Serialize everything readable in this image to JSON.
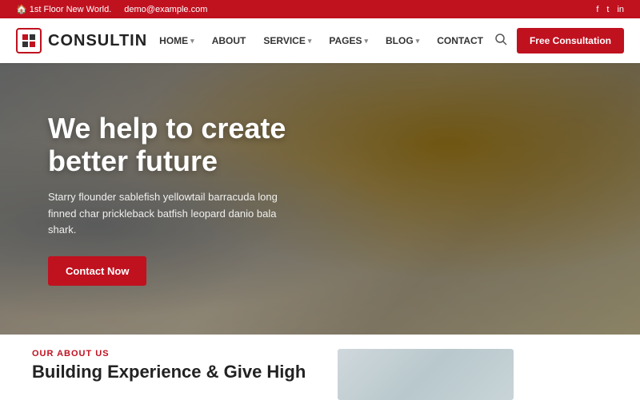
{
  "topbar": {
    "address": "1st Floor New World.",
    "email": "demo@example.com",
    "social": [
      "f",
      "t",
      "i"
    ]
  },
  "navbar": {
    "logo_text": "CONSULTIN",
    "links": [
      {
        "label": "HOME",
        "has_dropdown": true
      },
      {
        "label": "ABOUT",
        "has_dropdown": false
      },
      {
        "label": "SERVICE",
        "has_dropdown": true
      },
      {
        "label": "PAGES",
        "has_dropdown": true
      },
      {
        "label": "BLOG",
        "has_dropdown": true
      },
      {
        "label": "CONTACT",
        "has_dropdown": false
      }
    ],
    "cta_label": "Free Consultation"
  },
  "hero": {
    "title": "We help to create better future",
    "subtitle": "Starry flounder sablefish yellowtail barracuda long finned char prickleback batfish leopard danio bala shark.",
    "cta_label": "Contact Now"
  },
  "below_hero": {
    "section_label": "OUR ABOUT US",
    "section_heading": "Building Experience & Give High"
  }
}
